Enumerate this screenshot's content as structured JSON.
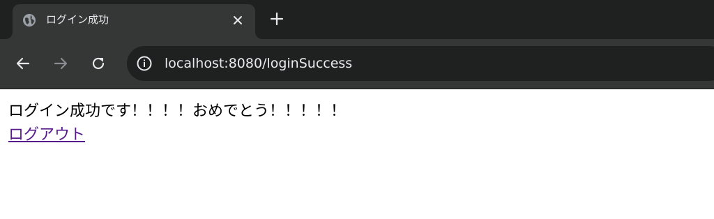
{
  "tab": {
    "title": "ログイン成功",
    "favicon": "globe-icon",
    "close_icon": "close-icon"
  },
  "new_tab_icon": "plus-icon",
  "toolbar": {
    "back_icon": "arrow-left-icon",
    "forward_icon": "arrow-right-icon",
    "reload_icon": "reload-icon",
    "site_info_icon": "info-icon",
    "url": "localhost:8080/loginSuccess"
  },
  "page": {
    "message": "ログイン成功です！！！！おめでとう！！！！！",
    "logout_link": "ログアウト"
  },
  "colors": {
    "tabstrip_bg": "#1f2020",
    "toolbar_bg": "#353636",
    "omnibox_bg": "#1f2020",
    "chrome_text": "#e8eaed",
    "visited_link": "#551a8b"
  }
}
